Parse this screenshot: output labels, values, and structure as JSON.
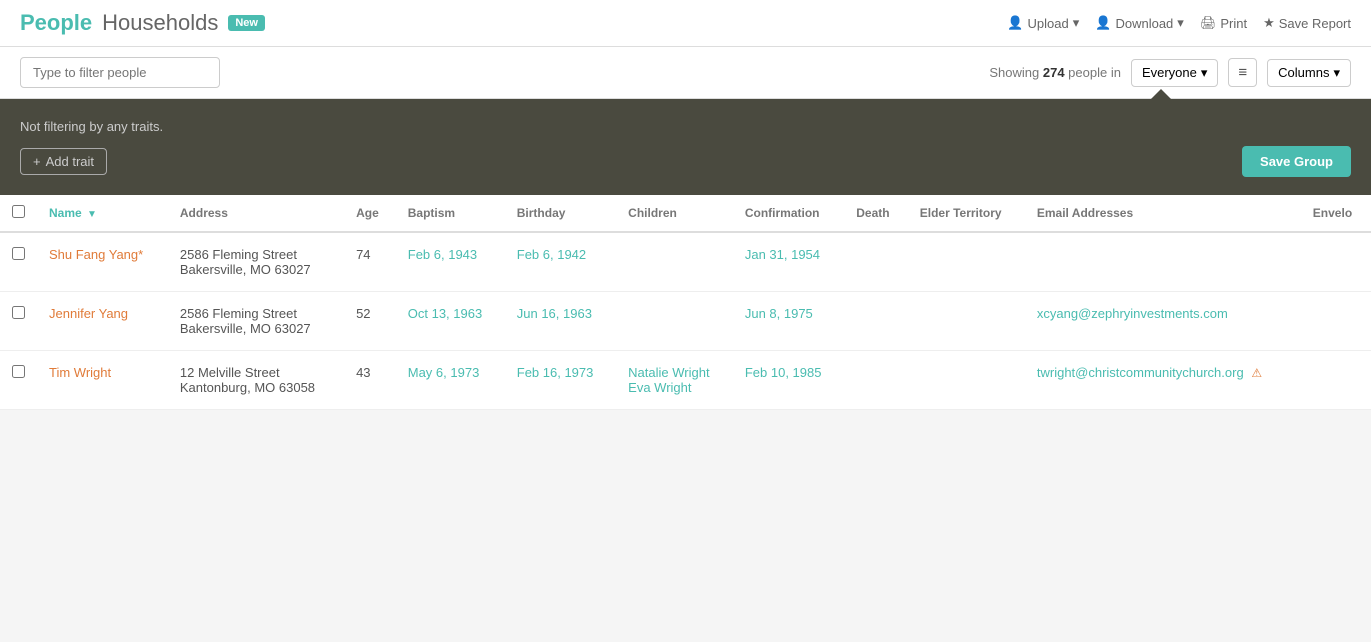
{
  "header": {
    "title_people": "People",
    "title_households": "Households",
    "new_badge": "New",
    "actions": [
      {
        "label": "Upload",
        "icon": "upload-icon"
      },
      {
        "label": "Download",
        "icon": "download-icon"
      },
      {
        "label": "Print",
        "icon": "print-icon"
      },
      {
        "label": "Save Report",
        "icon": "star-icon"
      }
    ]
  },
  "filter_bar": {
    "input_placeholder": "Type to filter people",
    "showing_prefix": "Showing ",
    "showing_count": "274",
    "showing_suffix": " people in",
    "everyone_label": "Everyone",
    "list_icon": "≡",
    "columns_label": "Columns"
  },
  "trait_panel": {
    "message": "Not filtering by any traits.",
    "add_trait_label": "Add trait",
    "save_group_label": "Save Group"
  },
  "table": {
    "columns": [
      "Name",
      "Address",
      "Age",
      "Baptism",
      "Birthday",
      "Children",
      "Confirmation",
      "Death",
      "Elder Territory",
      "Email Addresses",
      "Envelo"
    ],
    "rows": [
      {
        "name": "Shu Fang Yang*",
        "address_line1": "2586 Fleming Street",
        "address_line2": "Bakersville, MO  63027",
        "age": "74",
        "baptism": "Feb 6, 1943",
        "birthday": "Feb 6, 1942",
        "children": "",
        "confirmation": "Jan 31, 1954",
        "death": "",
        "elder_territory": "",
        "email_addresses": "",
        "has_email_warning": false
      },
      {
        "name": "Jennifer Yang",
        "address_line1": "2586 Fleming Street",
        "address_line2": "Bakersville, MO  63027",
        "age": "52",
        "baptism": "Oct 13, 1963",
        "birthday": "Jun 16, 1963",
        "children": "",
        "confirmation": "Jun 8, 1975",
        "death": "",
        "elder_territory": "",
        "email_addresses": "xcyang@zephryinvestments.com",
        "has_email_warning": false
      },
      {
        "name": "Tim Wright",
        "address_line1": "12 Melville Street",
        "address_line2": "Kantonburg, MO  63058",
        "age": "43",
        "baptism": "May 6, 1973",
        "birthday": "Feb 16, 1973",
        "children_line1": "Natalie Wright",
        "children_line2": "Eva Wright",
        "confirmation": "Feb 10, 1985",
        "death": "",
        "elder_territory": "",
        "email_addresses": "twright@christcommunitychurch.org",
        "has_email_warning": true
      }
    ]
  }
}
